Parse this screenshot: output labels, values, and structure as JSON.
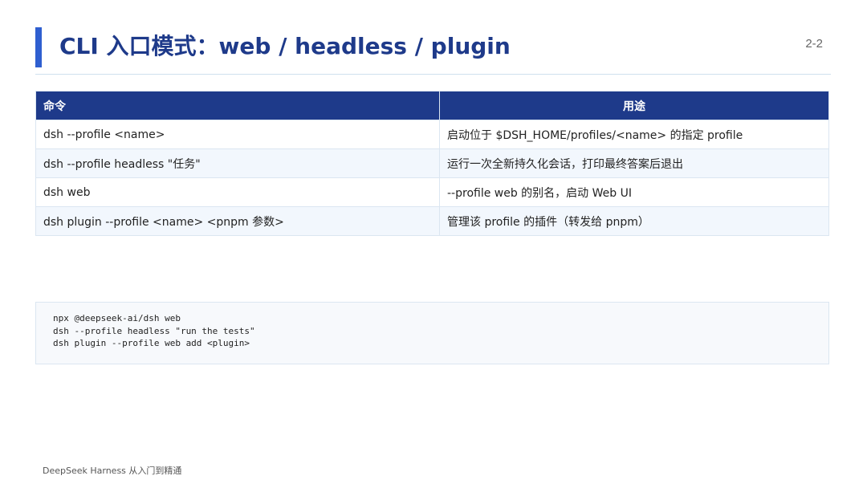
{
  "slide": {
    "title": "CLI 入口模式：web / headless / plugin",
    "page_number": "2-2",
    "footer": "DeepSeek Harness 从入门到精通"
  },
  "table": {
    "headers": [
      "命令",
      "用途"
    ],
    "rows": [
      [
        "dsh --profile <name>",
        "启动位于 $DSH_HOME/profiles/<name> 的指定 profile"
      ],
      [
        "dsh --profile headless \"任务\"",
        "运行一次全新持久化会话，打印最终答案后退出"
      ],
      [
        "dsh web",
        "--profile web 的别名，启动 Web UI"
      ],
      [
        "dsh plugin --profile <name> <pnpm 参数>",
        "管理该 profile 的插件（转发给 pnpm）"
      ]
    ]
  },
  "code": {
    "lines": [
      "npx @deepseek-ai/dsh web",
      "dsh --profile headless \"run the tests\"",
      "dsh plugin --profile web add <plugin>"
    ]
  },
  "colors": {
    "accent": "#2f5fd0",
    "title": "#1e3a8a",
    "header_bg": "#1e3a8a",
    "row_alt_bg": "#f2f7fd"
  }
}
